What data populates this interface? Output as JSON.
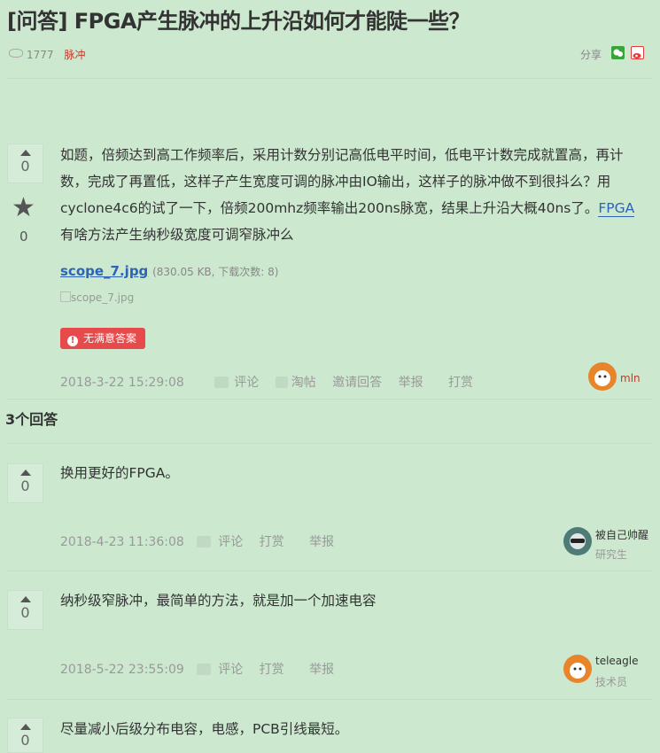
{
  "question": {
    "title": "[问答] FPGA产生脉冲的上升沿如何才能陡一些？",
    "views": "1777",
    "tag": "脉冲",
    "share_label": "分享",
    "votes": "0",
    "favorites": "0",
    "body_line1": "如题，倍频达到高工作频率后，采用计数分别记高低电平时间，低电平计数完成就置高，再计",
    "body_line2": "数，完成了再置低，这样子产生宽度可调的脉冲由IO输出，这样子的脉冲做不到很抖么？用",
    "body_line3": "cyclone4c6的试了一下，倍频200mhz频率输出200ns脉宽，结果上升沿大概40ns了。",
    "body_link": "FPGA",
    "body_line4": "有啥方法产生纳秒级宽度可调窄脉冲么",
    "attachment_name": "scope_7.jpg",
    "attachment_info": "(830.05 KB, 下载次数: 8)",
    "image_alt": "scope_7.jpg",
    "badge": "无满意答案",
    "date": "2018-3-22 15:29:08",
    "actions": {
      "comment": "评论",
      "taotie": "淘帖",
      "invite": "邀请回答",
      "report": "举报",
      "reward": "打赏"
    },
    "author": "mln"
  },
  "answers_count": "3个回答",
  "answers": [
    {
      "votes": "0",
      "text": "换用更好的FPGA。",
      "date": "2018-4-23 11:36:08",
      "comment": "评论",
      "reward": "打赏",
      "report": "举报",
      "author": "被自己帅醒",
      "role": "研究生"
    },
    {
      "votes": "0",
      "text": "纳秒级窄脉冲，最简单的方法，就是加一个加速电容",
      "date": "2018-5-22 23:55:09",
      "comment": "评论",
      "reward": "打赏",
      "report": "举报",
      "author": "teleagle",
      "role": "技术员"
    },
    {
      "votes": "0",
      "text": "尽量减小后级分布电容，电感，PCB引线最短。"
    }
  ],
  "colors": {
    "background": "#cce8cf",
    "link": "#2d63b8",
    "badge": "#e64a4a",
    "tag": "#c0392b",
    "wechat": "#3aa33a",
    "weibo": "#e4393c"
  },
  "icons": [
    "eye-icon",
    "wechat-icon",
    "weibo-icon",
    "upvote-icon",
    "star-icon",
    "comment-icon",
    "taotie-icon",
    "warning-icon"
  ]
}
